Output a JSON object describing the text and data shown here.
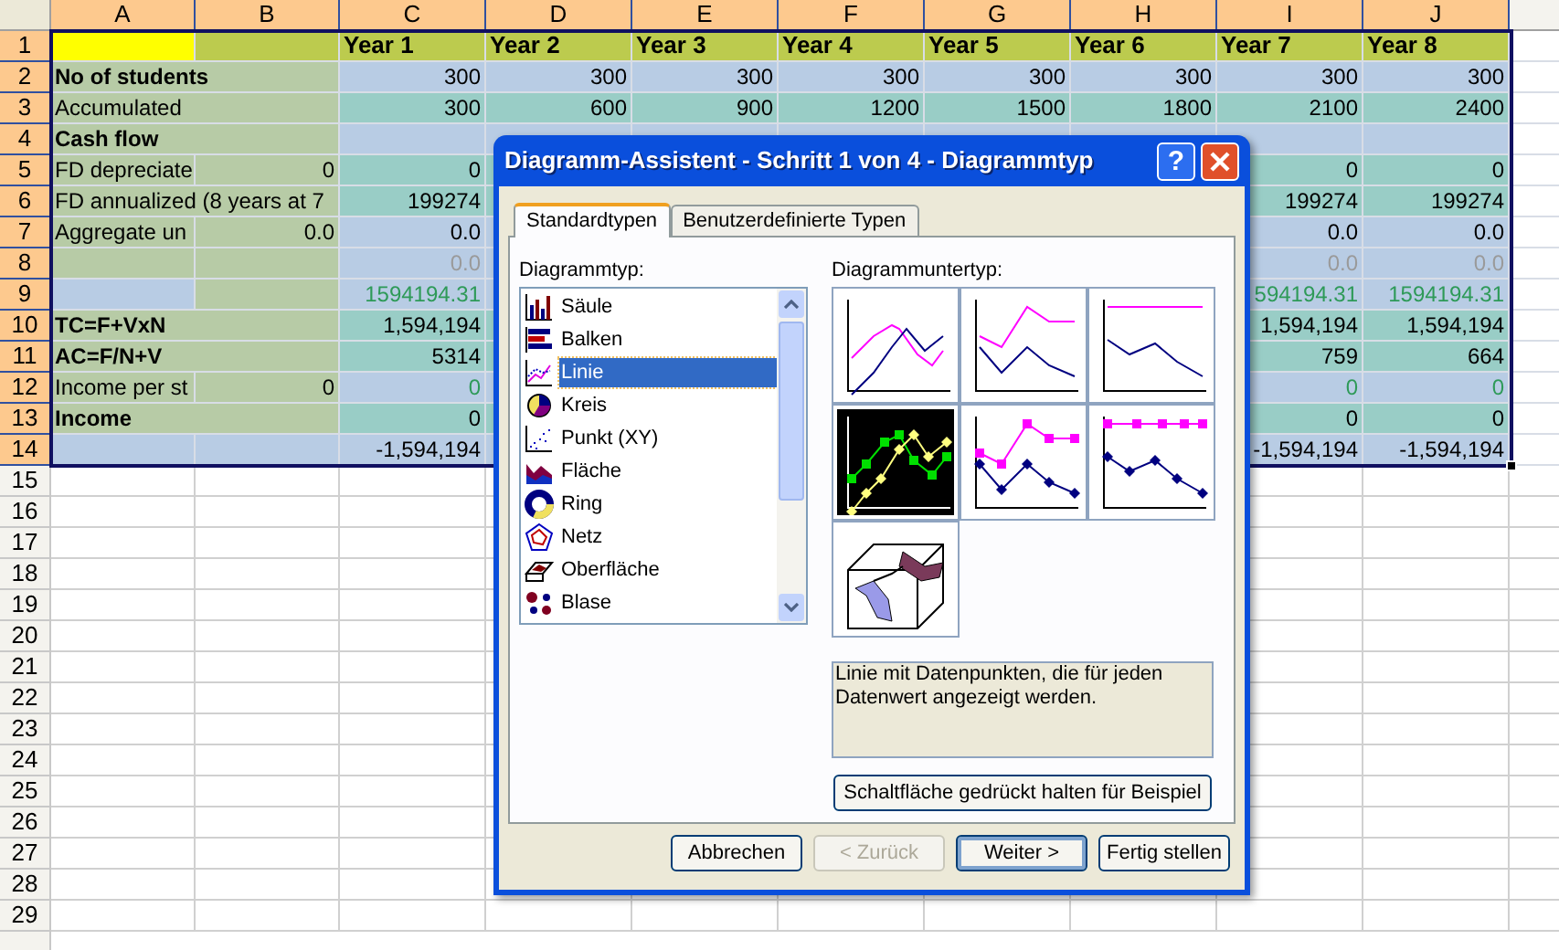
{
  "spreadsheet": {
    "columns": [
      {
        "label": "A",
        "selected": true
      },
      {
        "label": "B",
        "selected": true
      },
      {
        "label": "C",
        "selected": true
      },
      {
        "label": "D",
        "selected": true
      },
      {
        "label": "E",
        "selected": true
      },
      {
        "label": "F",
        "selected": true
      },
      {
        "label": "G",
        "selected": true
      },
      {
        "label": "H",
        "selected": true
      },
      {
        "label": "I",
        "selected": true
      },
      {
        "label": "J",
        "selected": true
      }
    ],
    "row_headers": [
      {
        "label": "1",
        "selected": true
      },
      {
        "label": "2",
        "selected": true
      },
      {
        "label": "3",
        "selected": true
      },
      {
        "label": "4",
        "selected": true
      },
      {
        "label": "5",
        "selected": true
      },
      {
        "label": "6",
        "selected": true
      },
      {
        "label": "7",
        "selected": true
      },
      {
        "label": "8",
        "selected": true
      },
      {
        "label": "9",
        "selected": true
      },
      {
        "label": "10",
        "selected": true
      },
      {
        "label": "11",
        "selected": true
      },
      {
        "label": "12",
        "selected": true
      },
      {
        "label": "13",
        "selected": true
      },
      {
        "label": "14",
        "selected": true
      },
      {
        "label": "15",
        "selected": false
      },
      {
        "label": "16",
        "selected": false
      },
      {
        "label": "17",
        "selected": false
      },
      {
        "label": "18",
        "selected": false
      },
      {
        "label": "19",
        "selected": false
      },
      {
        "label": "20",
        "selected": false
      },
      {
        "label": "21",
        "selected": false
      },
      {
        "label": "22",
        "selected": false
      },
      {
        "label": "23",
        "selected": false
      },
      {
        "label": "24",
        "selected": false
      },
      {
        "label": "25",
        "selected": false
      },
      {
        "label": "26",
        "selected": false
      },
      {
        "label": "27",
        "selected": false
      },
      {
        "label": "28",
        "selected": false
      },
      {
        "label": "29",
        "selected": false
      }
    ],
    "rows": [
      {
        "kind": "header",
        "c": "Year 1",
        "d": "Year 2",
        "e": "Year 3",
        "f": "Year 4",
        "g": "Year 5",
        "h": "Year 6",
        "i": "Year 7",
        "j": "Year 8"
      },
      {
        "kind": "blue",
        "label": "No of students",
        "bold": true,
        "c": "300",
        "d": "300",
        "e": "300",
        "f": "300",
        "g": "300",
        "h": "300",
        "i": "300",
        "j": "300"
      },
      {
        "kind": "teal",
        "label": "Accumulated",
        "bold": false,
        "c": "300",
        "d": "600",
        "e": "900",
        "f": "1200",
        "g": "1500",
        "h": "1800",
        "i": "2100",
        "j": "2400"
      },
      {
        "kind": "blue",
        "label": "Cash flow",
        "bold": true
      },
      {
        "kind": "teal",
        "label": "FD depreciate",
        "bold": false,
        "b": "0",
        "c": "0",
        "i": "0",
        "j": "0"
      },
      {
        "kind": "teal",
        "label": "FD annualized (8 years at 7",
        "bold": false,
        "c": "199274",
        "i": "199274",
        "j": "199274"
      },
      {
        "kind": "blue",
        "label": "Aggregate un",
        "bold": false,
        "b": "0.0",
        "c": "0.0",
        "i": "0.0",
        "j": "0.0"
      },
      {
        "kind": "blue",
        "color": "#9a9a9a",
        "c": "0.0",
        "i": "0.0",
        "j": "0.0"
      },
      {
        "kind": "subtotal",
        "color": "#2e9a58",
        "c": "1594194.31",
        "i": "594194.31",
        "j": "1594194.31"
      },
      {
        "kind": "teal",
        "label": "TC=F+VxN",
        "bold": true,
        "c": "1,594,194",
        "i": "1,594,194",
        "j": "1,594,194"
      },
      {
        "kind": "teal",
        "label": "AC=F/N+V",
        "bold": true,
        "c": "5314",
        "i": "759",
        "j": "664"
      },
      {
        "kind": "blue",
        "label": "Income per st",
        "bold": false,
        "b": "0",
        "color": "#2e9a58",
        "c": "0",
        "i": "0",
        "j": "0"
      },
      {
        "kind": "teal",
        "label": "Income",
        "bold": true,
        "c": "0",
        "i": "0",
        "j": "0"
      },
      {
        "kind": "total",
        "c": "-1,594,194",
        "i": "-1,594,194",
        "j": "-1,594,194"
      }
    ]
  },
  "dialog": {
    "title": "Diagramm-Assistent - Schritt 1 von 4 - Diagrammtyp",
    "help": "?",
    "tabs": [
      {
        "label": "Standardtypen",
        "selected": true
      },
      {
        "label": "Benutzerdefinierte Typen",
        "selected": false
      }
    ],
    "type_label": "Diagrammtyp:",
    "types": [
      {
        "label": "Säule",
        "kind": "column",
        "selected": false
      },
      {
        "label": "Balken",
        "kind": "bar",
        "selected": false
      },
      {
        "label": "Linie",
        "kind": "line",
        "selected": true
      },
      {
        "label": "Kreis",
        "kind": "pie",
        "selected": false
      },
      {
        "label": "Punkt (XY)",
        "kind": "scatter",
        "selected": false
      },
      {
        "label": "Fläche",
        "kind": "area",
        "selected": false
      },
      {
        "label": "Ring",
        "kind": "ring",
        "selected": false
      },
      {
        "label": "Netz",
        "kind": "radar",
        "selected": false
      },
      {
        "label": "Oberfläche",
        "kind": "surface",
        "selected": false
      },
      {
        "label": "Blase",
        "kind": "bubble",
        "selected": false
      }
    ],
    "subtype_label": "Diagrammuntertyp:",
    "subtypes": [
      {
        "kind": "line",
        "selected": false
      },
      {
        "kind": "stacked",
        "selected": false
      },
      {
        "kind": "percent",
        "selected": false
      },
      {
        "kind": "markers",
        "selected": true
      },
      {
        "kind": "stackedmarkers",
        "selected": false
      },
      {
        "kind": "percentmarkers",
        "selected": false
      },
      {
        "kind": "surface",
        "selected": false
      }
    ],
    "description": "Linie mit Datenpunkten, die für jeden Datenwert angezeigt werden.",
    "preview_button": "Schaltfläche gedrückt halten für Beispiel",
    "buttons": [
      {
        "label": "Abbrechen",
        "disabled": false,
        "default": false
      },
      {
        "label": "< Zurück",
        "disabled": true,
        "default": false
      },
      {
        "label": "Weiter >",
        "disabled": false,
        "default": true
      },
      {
        "label": "Fertig stellen",
        "disabled": false,
        "default": false
      }
    ]
  }
}
